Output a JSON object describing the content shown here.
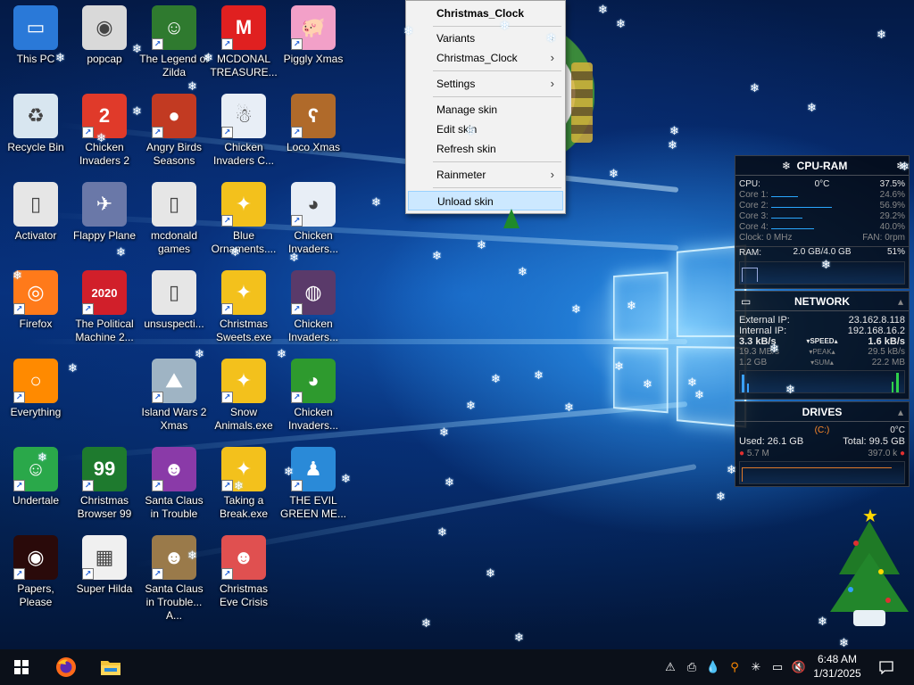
{
  "desktop_icons": [
    {
      "label": "This PC",
      "icon": "this-pc-icon",
      "color": "#2a79d8",
      "glyph": "▭",
      "shortcut": false
    },
    {
      "label": "popcap",
      "icon": "popcap-folder-icon",
      "color": "#d9d9d9",
      "glyph": "◉",
      "shortcut": false
    },
    {
      "label": "The Legend of Zilda",
      "icon": "zelda-icon",
      "color": "#2f7a2f",
      "glyph": "☺",
      "shortcut": true
    },
    {
      "label": "MCDONAL TREASURE...",
      "icon": "mcdonalds-icon",
      "color": "#e02020",
      "glyph": "M",
      "shortcut": true
    },
    {
      "label": "Piggly Xmas",
      "icon": "pig-icon",
      "color": "#f2a0c8",
      "glyph": "🐖",
      "shortcut": true
    },
    {
      "label": "Recycle Bin",
      "icon": "recycle-bin-icon",
      "color": "#d8e6f0",
      "glyph": "♻",
      "shortcut": false
    },
    {
      "label": "Chicken Invaders 2",
      "icon": "chicken-icon",
      "color": "#e03a2a",
      "glyph": "2",
      "shortcut": true
    },
    {
      "label": "Angry Birds Seasons",
      "icon": "angry-birds-icon",
      "color": "#c23a22",
      "glyph": "●",
      "shortcut": true
    },
    {
      "label": "Chicken Invaders C...",
      "icon": "chicken-snowman-icon",
      "color": "#e8eef6",
      "glyph": "☃",
      "shortcut": true
    },
    {
      "label": "Loco Xmas",
      "icon": "bear-icon",
      "color": "#b06a2a",
      "glyph": "ʕ",
      "shortcut": true
    },
    {
      "label": "Activator",
      "icon": "activator-icon",
      "color": "#e6e6e6",
      "glyph": "▯",
      "shortcut": false
    },
    {
      "label": "Flappy Plane",
      "icon": "flappy-plane-icon",
      "color": "#6a78a8",
      "glyph": "✈",
      "shortcut": false
    },
    {
      "label": "mcdonald games",
      "icon": "folder-icon",
      "color": "#e6e6e6",
      "glyph": "▯",
      "shortcut": false
    },
    {
      "label": "Blue Ornaments....",
      "icon": "pinwheel-icon",
      "color": "#f3c11c",
      "glyph": "✦",
      "shortcut": true
    },
    {
      "label": "Chicken Invaders...",
      "icon": "chicken-santa-icon",
      "color": "#e8eef6",
      "glyph": "◕",
      "shortcut": true
    },
    {
      "label": "Firefox",
      "icon": "firefox-icon",
      "color": "#ff7a1a",
      "glyph": "◎",
      "shortcut": true
    },
    {
      "label": "The Political Machine 2...",
      "icon": "political-machine-icon",
      "color": "#d11f2a",
      "glyph": "2020",
      "shortcut": true
    },
    {
      "label": "unsuspecti...",
      "icon": "document-icon",
      "color": "#e6e6e6",
      "glyph": "▯",
      "shortcut": false
    },
    {
      "label": "Christmas Sweets.exe",
      "icon": "pinwheel-icon",
      "color": "#f3c11c",
      "glyph": "✦",
      "shortcut": true
    },
    {
      "label": "Chicken Invaders...",
      "icon": "chicken-planet-icon",
      "color": "#5a3a6a",
      "glyph": "◍",
      "shortcut": true
    },
    {
      "label": "Everything",
      "icon": "magnifier-icon",
      "color": "#ff8a00",
      "glyph": "○",
      "shortcut": true
    },
    {
      "label": "Island Wars 2 Xmas",
      "icon": "island-wars-icon",
      "color": "#9fb4c4",
      "glyph": "⛰",
      "shortcut": true
    },
    {
      "label": "Snow Animals.exe",
      "icon": "pinwheel-icon",
      "color": "#f3c11c",
      "glyph": "✦",
      "shortcut": true
    },
    {
      "label": "Chicken Invaders...",
      "icon": "chicken-green-icon",
      "color": "#2e9a2e",
      "glyph": "◕",
      "shortcut": true
    },
    {
      "label": "Undertale",
      "icon": "undertale-icon",
      "color": "#2aa84a",
      "glyph": "☺",
      "shortcut": true
    },
    {
      "label": "Christmas Browser 99",
      "icon": "xmas-tree-icon",
      "color": "#1e7a2e",
      "glyph": "99",
      "shortcut": true
    },
    {
      "label": "Santa Claus in Trouble",
      "icon": "santa-icon",
      "color": "#8a3aa8",
      "glyph": "☻",
      "shortcut": true
    },
    {
      "label": "Taking a Break.exe",
      "icon": "pinwheel-icon",
      "color": "#f3c11c",
      "glyph": "✦",
      "shortcut": true
    },
    {
      "label": "THE EVIL GREEN ME...",
      "icon": "messenger-icon",
      "color": "#2a8ad8",
      "glyph": "♟",
      "shortcut": true
    },
    {
      "label": "Papers, Please",
      "icon": "papers-please-icon",
      "color": "#2a0a0a",
      "glyph": "◉",
      "shortcut": true
    },
    {
      "label": "Super Hilda",
      "icon": "pixel-dog-icon",
      "color": "#f0f0f0",
      "glyph": "▦",
      "shortcut": true
    },
    {
      "label": "Santa Claus in Trouble... A...",
      "icon": "santa-icon",
      "color": "#9a7a4a",
      "glyph": "☻",
      "shortcut": true
    },
    {
      "label": "Christmas Eve Crisis",
      "icon": "santa-icon",
      "color": "#e05050",
      "glyph": "☻",
      "shortcut": true
    }
  ],
  "context_menu": {
    "title": "Christmas_Clock",
    "items": [
      {
        "label": "Variants",
        "submenu": true
      },
      {
        "label": "Christmas_Clock",
        "submenu": true
      },
      {
        "label": "Settings",
        "submenu": true
      },
      {
        "label": "Manage skin",
        "submenu": false
      },
      {
        "label": "Edit skin",
        "submenu": false
      },
      {
        "label": "Refresh skin",
        "submenu": false
      },
      {
        "label": "Rainmeter",
        "submenu": true
      },
      {
        "label": "Unload skin",
        "submenu": false
      }
    ],
    "highlighted": "Unload skin"
  },
  "cpu_ram": {
    "title": "CPU-RAM",
    "cpu_label": "CPU:",
    "cpu_temp": "0°C",
    "cpu_value": "37.5%",
    "cores": [
      {
        "label": "Core 1:",
        "value": "24.6%",
        "pct": 24.6
      },
      {
        "label": "Core 2:",
        "value": "56.9%",
        "pct": 56.9
      },
      {
        "label": "Core 3:",
        "value": "29.2%",
        "pct": 29.2
      },
      {
        "label": "Core 4:",
        "value": "40.0%",
        "pct": 40.0
      }
    ],
    "clock": "Clock: 0 MHz",
    "fan": "FAN: 0rpm",
    "ram_label": "RAM:",
    "ram_value": "2.0 GB/4.0 GB",
    "ram_pct": "51%"
  },
  "network": {
    "title": "NETWORK",
    "external_label": "External IP:",
    "external_ip": "23.162.8.118",
    "internal_label": "Internal IP:",
    "internal_ip": "192.168.16.2",
    "speed_down": "3.3 kB/s",
    "speed_label": "SPEED",
    "speed_up": "1.6 kB/s",
    "peak_down": "19.3 MB/s",
    "peak_label": "PEAK",
    "peak_up": "29.5 kB/s",
    "sum_down": "1.2 GB",
    "sum_label": "SUM",
    "sum_up": "22.2 MB"
  },
  "drives": {
    "title": "DRIVES",
    "drive": "(C:)",
    "temp": "0°C",
    "used": "Used: 26.1 GB",
    "total": "Total: 99.5 GB",
    "read": "5.7 M",
    "write": "397.0 k"
  },
  "taskbar": {
    "time": "6:48 AM",
    "date": "1/31/2025",
    "pinned": [
      {
        "name": "start-button",
        "icon": "windows-icon"
      },
      {
        "name": "taskbar-firefox",
        "icon": "firefox-icon"
      },
      {
        "name": "taskbar-file-explorer",
        "icon": "folder-icon"
      }
    ],
    "tray": [
      "virus-alert-icon",
      "printer-error-icon",
      "rainmeter-drop-icon",
      "everything-search-icon",
      "snowflake-icon",
      "network-disconnected-icon",
      "volume-muted-icon"
    ]
  }
}
